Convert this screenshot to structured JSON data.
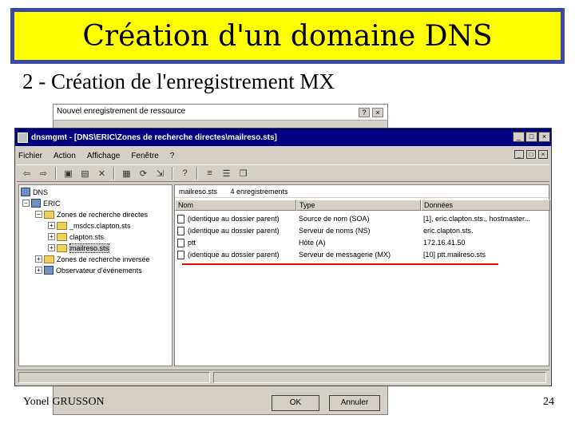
{
  "slide": {
    "title": "Création d'un domaine DNS",
    "subtitle": "2 - Création de l'enregistrement MX",
    "footer_author": "Yonel GRUSSON",
    "page_number": "24"
  },
  "dialog": {
    "title": "Nouvel enregistrement de ressource",
    "help": "?",
    "close": "×",
    "ok_label": "OK",
    "cancel_label": "Annuler"
  },
  "window": {
    "title": "dnsmgmt - [DNS\\ERIC\\Zones de recherche directes\\mailreso.sts]",
    "min": "_",
    "max": "□",
    "close": "×",
    "inner_min": "_",
    "inner_max": "□",
    "inner_close": "×"
  },
  "menu": [
    "Fichier",
    "Action",
    "Affichage",
    "Fenêtre",
    "?"
  ],
  "tree": {
    "root": "DNS",
    "server": "ERIC",
    "forward_zones": "Zones de recherche directes",
    "zone1": "_msdcs.clapton.sts",
    "zone2": "clapton.sts",
    "zone3": "mailreso.sts",
    "reverse_zones": "Zones de recherche inversée",
    "event_viewer": "Observateur d'événements"
  },
  "list": {
    "zone_name": "mailreso.sts",
    "record_count": "4 enregistrements",
    "columns": [
      "Nom",
      "Type",
      "Données"
    ],
    "rows": [
      {
        "name": "(identique au dossier parent)",
        "type": "Source de nom (SOA)",
        "data": "[1], eric.clapton.sts., hostmaster..."
      },
      {
        "name": "(identique au dossier parent)",
        "type": "Serveur de noms (NS)",
        "data": "eric.clapton.sts."
      },
      {
        "name": "ptt",
        "type": "Hôte (A)",
        "data": "172.16.41.50"
      },
      {
        "name": "(identique au dossier parent)",
        "type": "Serveur de messagerie (MX)",
        "data": "[10] ptt.mailreso.sts"
      }
    ]
  },
  "colors": {
    "title_bg": "#ffff00",
    "title_border": "#3b4aa8",
    "window_titlebar": "#000080",
    "highlight_underline": "#ff0000"
  }
}
